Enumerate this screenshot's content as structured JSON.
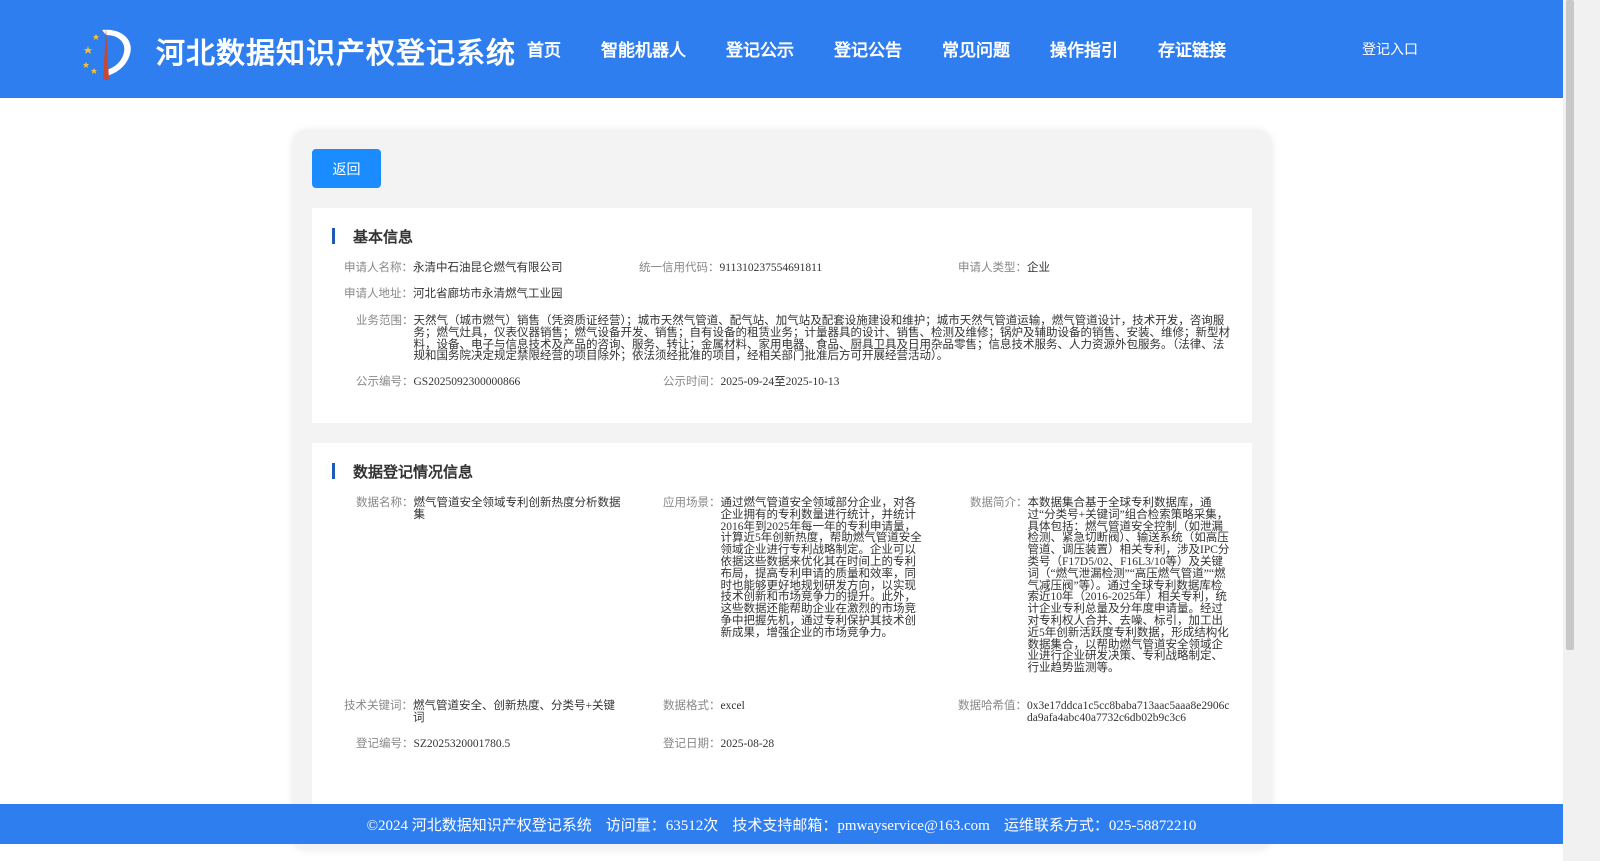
{
  "header": {
    "logo_icon": "spire-logo-icon",
    "title": "河北数据知识产权登记系统",
    "nav": [
      "首页",
      "智能机器人",
      "登记公示",
      "登记公告",
      "常见问题",
      "操作指引",
      "存证链接"
    ],
    "login": "登记入口"
  },
  "actions": {
    "back": "返回"
  },
  "basic": {
    "title": "基本信息",
    "applicant_name_label": "申请人名称：",
    "applicant_name": "永清中石油昆仑燃气有限公司",
    "credit_code_label": "统一信用代码：",
    "credit_code": "911310237554691811",
    "applicant_type_label": "申请人类型：",
    "applicant_type": "企业",
    "address_label": "申请人地址：",
    "address": "河北省廊坊市永清燃气工业园",
    "scope_label": "业务范围：",
    "scope": "天然气（城市燃气）销售（凭资质证经营）；城市天然气管道、配气站、加气站及配套设施建设和维护；城市天然气管道运输，燃气管道设计，技术开发，咨询服务；燃气灶具，仪表仪器销售；燃气设备开发、销售；自有设备的租赁业务；计量器具的设计、销售、检测及维修；锅炉及辅助设备的销售、安装、维修；新型材料，设备、电子与信息技术及产品的咨询、服务、转让；金属材料、家用电器、食品、厨具卫具及日用杂品零售；信息技术服务、人力资源外包服务。（法律、法规和国务院决定规定禁限经营的项目除外；依法须经批准的项目，经相关部门批准后方可开展经营活动）。",
    "pub_no_label": "公示编号：",
    "pub_no": "GS2025092300000866",
    "pub_time_label": "公示时间：",
    "pub_time": "2025-09-24至2025-10-13"
  },
  "registration": {
    "title": "数据登记情况信息",
    "data_name_label": "数据名称：",
    "data_name": "燃气管道安全领域专利创新热度分析数据集",
    "scenario_label": "应用场景：",
    "scenario": "通过燃气管道安全领域部分企业，对各企业拥有的专利数量进行统计，并统计2016年到2025年每一年的专利申请量，计算近5年创新热度，帮助燃气管道安全领域企业进行专利战略制定。企业可以依据这些数据来优化其在时间上的专利布局，提高专利申请的质量和效率，同时也能够更好地规划研发方向，以实现技术创新和市场竞争力的提升。此外，这些数据还能帮助企业在激烈的市场竞争中把握先机，通过专利保护其技术创新成果，增强企业的市场竞争力。",
    "intro_label": "数据简介：",
    "intro": "本数据集合基于全球专利数据库，通过“分类号+关键词”组合检索策略采集，具体包括：燃气管道安全控制（如泄漏检测、紧急切断阀）、输送系统（如高压管道、调压装置）相关专利，涉及IPC分类号（F17D5/02、F16L3/10等）及关键词（“燃气泄漏检测”“高压燃气管道”“燃气减压阀”等）。通过全球专利数据库检索近10年（2016-2025年）相关专利，统计企业专利总量及分年度申请量。经过对专利权人合并、去噪、标引，加工出近5年创新活跃度专利数据，形成结构化数据集合，以帮助燃气管道安全领域企业进行企业研发决策、专利战略制定、行业趋势监测等。",
    "keywords_label": "技术关键词：",
    "keywords": "燃气管道安全、创新热度、分类号+关键词",
    "format_label": "数据格式：",
    "format": "excel",
    "hash_label": "数据哈希值：",
    "hash": "0x3e17ddca1c5cc8baba713aac5aaa8e2906cda9afa4abc40a7732c6db02b9c3c6",
    "reg_no_label": "登记编号：",
    "reg_no": "SZ2025320001780.5",
    "reg_date_label": "登记日期：",
    "reg_date": "2025-08-28"
  },
  "footer": {
    "copyright": "©2024 河北数据知识产权登记系统",
    "visits": "访问量：63512次",
    "email": "技术支持邮箱：pmwayservice@163.com",
    "phone": "运维联系方式：025-58872210"
  },
  "colors": {
    "primary": "#2f7ef0",
    "button": "#1a8cff",
    "section_bar": "#1e5bb8"
  }
}
